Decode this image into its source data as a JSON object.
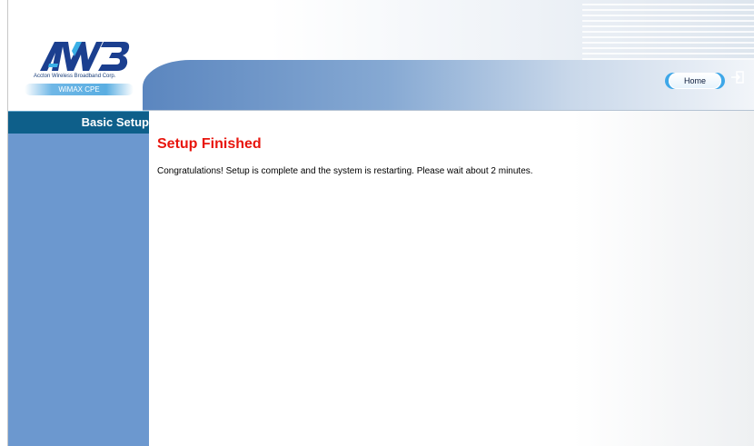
{
  "header": {
    "logo": {
      "mark": "AWB",
      "company": "Accton Wireless Broadband Corp.",
      "product": "WiMAX CPE"
    },
    "home_label": "Home",
    "logout_icon": "logout-icon"
  },
  "sidebar": {
    "section_label": "Basic Setup"
  },
  "main": {
    "title": "Setup Finished",
    "message": "Congratulations! Setup is complete and the system is restarting. Please wait about 2 minutes."
  },
  "colors": {
    "title": "#e8150d",
    "sidebar": "#6c98cf",
    "sidebar_header": "#0e5f8a",
    "banner": "#5b86bf"
  }
}
